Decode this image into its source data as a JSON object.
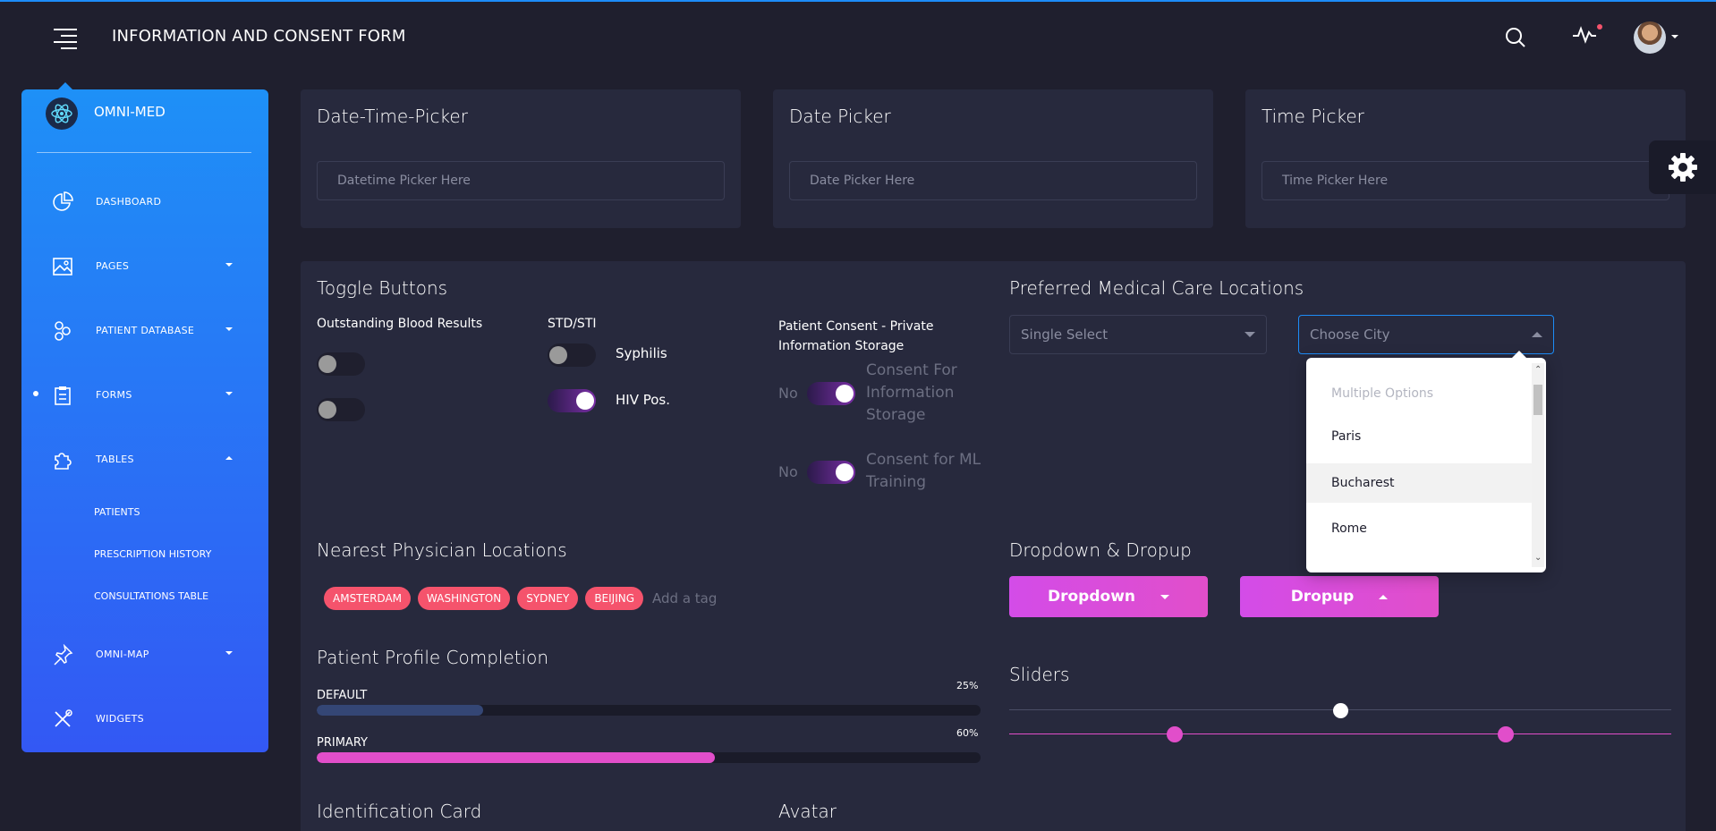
{
  "header": {
    "title": "INFORMATION AND CONSENT FORM"
  },
  "sidebar": {
    "brand": "OMNI-MED",
    "items": [
      {
        "label": "DASHBOARD"
      },
      {
        "label": "PAGES"
      },
      {
        "label": "PATIENT DATABASE"
      },
      {
        "label": "FORMS"
      },
      {
        "label": "TABLES"
      },
      {
        "label": "OMNI-MAP"
      },
      {
        "label": "WIDGETS"
      }
    ],
    "tables_sub": [
      "PATIENTS",
      "PRESCRIPTION HISTORY",
      "CONSULTATIONS TABLE"
    ]
  },
  "pickers": {
    "datetime": {
      "title": "Date-Time-Picker",
      "placeholder": "Datetime Picker Here"
    },
    "date": {
      "title": "Date Picker",
      "placeholder": "Date Picker Here"
    },
    "time": {
      "title": "Time Picker",
      "placeholder": "Time Picker Here"
    }
  },
  "toggles": {
    "title": "Toggle Buttons",
    "col1": {
      "label": "Outstanding Blood Results",
      "states": [
        false,
        false
      ]
    },
    "col2": {
      "label": "STD/STI",
      "items": [
        {
          "label": "Syphilis",
          "on": false
        },
        {
          "label": "HIV Pos.",
          "on": true
        }
      ]
    },
    "col3": {
      "label": "Patient Consent - Private Information Storage",
      "items": [
        {
          "prefix": "No",
          "label": "Consent For Information Storage",
          "on": true
        },
        {
          "prefix": "No",
          "label": "Consent for ML Training",
          "on": true
        }
      ]
    }
  },
  "locations": {
    "title": "Preferred Medical Care Locations",
    "single_select": "Single Select",
    "city_select": "Choose City",
    "options": [
      "Multiple Options",
      "Paris",
      "Bucharest",
      "Rome"
    ],
    "highlighted": "Bucharest"
  },
  "physicians": {
    "title": "Nearest Physician Locations",
    "tags": [
      "AMSTERDAM",
      "WASHINGTON",
      "SYDNEY",
      "BEIJING"
    ],
    "placeholder": "Add a tag"
  },
  "dropdowns": {
    "title": "Dropdown & Dropup",
    "dropdown": "Dropdown",
    "dropup": "Dropup"
  },
  "progress": {
    "title": "Patient Profile Completion",
    "bars": [
      {
        "label": "DEFAULT",
        "value_text": "25%",
        "value": 25,
        "color": "#344675"
      },
      {
        "label": "PRIMARY",
        "value_text": "60%",
        "value": 60,
        "color": "#e14eca"
      }
    ]
  },
  "sliders": {
    "title": "Sliders",
    "single": 50,
    "range": [
      25,
      75
    ],
    "accent": "#e14eca"
  },
  "bottom": {
    "id_card": "Identification Card",
    "avatar": "Avatar"
  },
  "colors": {
    "primary": "#1d8cf8",
    "pink": "#e14eca",
    "tag": "#f5536c",
    "card": "#27293d",
    "bg": "#1f1f2e"
  }
}
